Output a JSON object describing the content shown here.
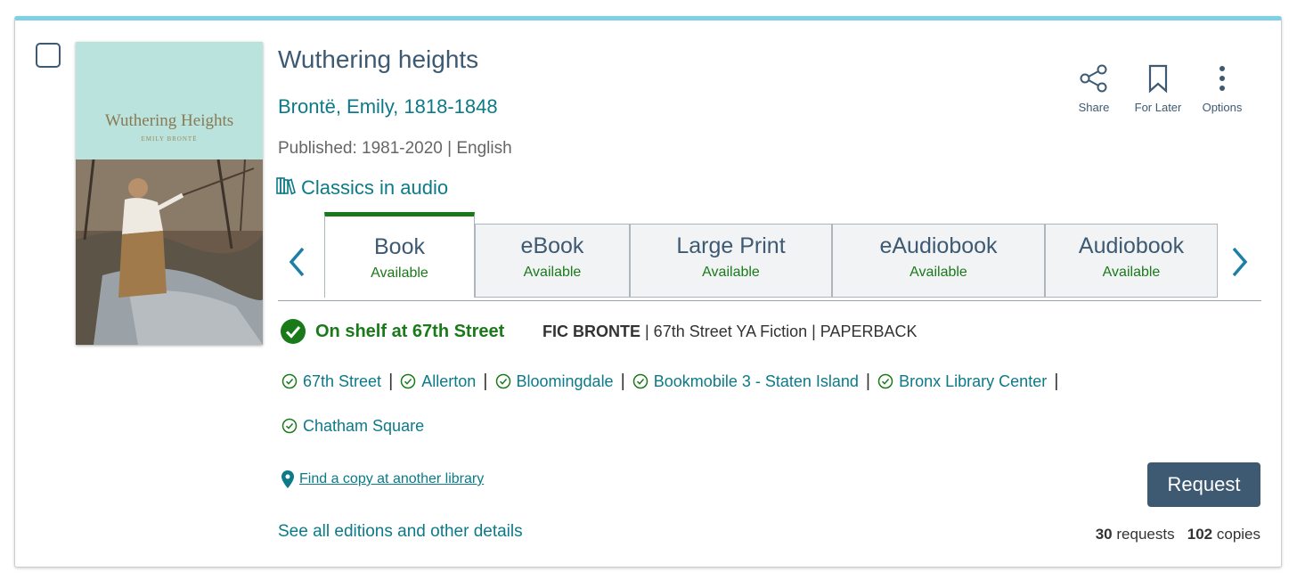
{
  "record": {
    "title": "Wuthering heights",
    "author": "Brontë, Emily, 1818-1848",
    "published": "Published: 1981-2020 | English",
    "series": "Classics in audio",
    "cover": {
      "title": "Wuthering Heights",
      "author": "EMILY BRONTË"
    }
  },
  "actions": [
    {
      "label": "Share",
      "icon": "share-icon"
    },
    {
      "label": "For Later",
      "icon": "bookmark-icon"
    },
    {
      "label": "Options",
      "icon": "more-vertical-icon"
    }
  ],
  "formats": [
    {
      "name": "Book",
      "status": "Available",
      "active": true
    },
    {
      "name": "eBook",
      "status": "Available",
      "active": false
    },
    {
      "name": "Large Print",
      "status": "Available",
      "active": false
    },
    {
      "name": "eAudiobook",
      "status": "Available",
      "active": false
    },
    {
      "name": "Audiobook",
      "status": "Available",
      "active": false
    }
  ],
  "availability": {
    "shelf_text": "On shelf at 67th Street",
    "call_number": "FIC BRONTE",
    "call_details": " | 67th Street YA Fiction | PAPERBACK"
  },
  "branches": [
    "67th Street",
    "Allerton",
    "Bloomingdale",
    "Bookmobile 3 - Staten Island",
    "Bronx Library Center",
    "Chatham Square"
  ],
  "links": {
    "find_copy": "Find a copy at another library",
    "editions": "See all editions and other details"
  },
  "request": {
    "button_label": "Request",
    "requests_count": "30",
    "requests_label": "requests",
    "copies_count": "102",
    "copies_label": "copies"
  },
  "colors": {
    "accent_border": "#7fd0e2",
    "link": "#0c7a88",
    "heading": "#3d5a72",
    "available": "#1a7a1a"
  }
}
